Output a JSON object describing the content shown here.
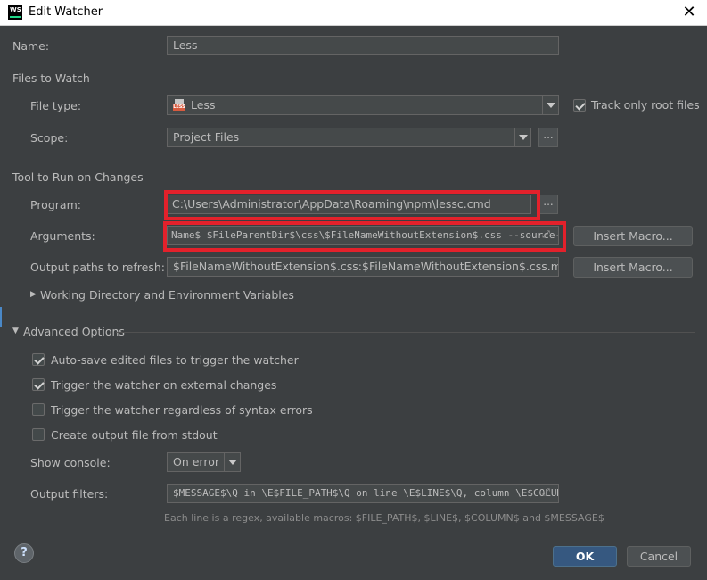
{
  "window": {
    "title": "Edit Watcher",
    "app_icon_text": "WS"
  },
  "name": {
    "label": "Name:",
    "value": "Less"
  },
  "files_to_watch": {
    "section": "Files to Watch",
    "file_type_label": "File type:",
    "file_type_value": "Less",
    "file_type_icon_text": "LESS",
    "track_root_label": "Track only root files",
    "track_root_checked": true,
    "scope_label": "Scope:",
    "scope_value": "Project Files",
    "scope_more": "..."
  },
  "tool": {
    "section": "Tool to Run on Changes",
    "program_label": "Program:",
    "program_value": "C:\\Users\\Administrator\\AppData\\Roaming\\npm\\lessc.cmd",
    "program_more": "...",
    "arguments_label": "Arguments:",
    "arguments_value": "Name$ $FileParentDir$\\css\\$FileNameWithoutExtension$.css --source-map",
    "insert_macro_label": "Insert Macro...",
    "output_label": "Output paths to refresh:",
    "output_value": "$FileNameWithoutExtension$.css:$FileNameWithoutExtension$.css.map",
    "working_dir_label": "Working Directory and Environment Variables"
  },
  "advanced": {
    "section": "Advanced Options",
    "options": [
      {
        "label": "Auto-save edited files to trigger the watcher",
        "checked": true
      },
      {
        "label": "Trigger the watcher on external changes",
        "checked": true
      },
      {
        "label": "Trigger the watcher regardless of syntax errors",
        "checked": false
      },
      {
        "label": "Create output file from stdout",
        "checked": false
      }
    ],
    "show_console_label": "Show console:",
    "show_console_value": "On error",
    "output_filters_label": "Output filters:",
    "output_filters_value": "$MESSAGE$\\Q in \\E$FILE_PATH$\\Q on line \\E$LINE$\\Q, column \\E$COLUMN$",
    "hint": "Each line is a regex, available macros: $FILE_PATH$, $LINE$, $COLUMN$ and $MESSAGE$"
  },
  "footer": {
    "help": "?",
    "ok": "OK",
    "cancel": "Cancel"
  },
  "colors": {
    "background": "#3c3f41",
    "highlight": "#e3212b",
    "primary": "#365880"
  }
}
